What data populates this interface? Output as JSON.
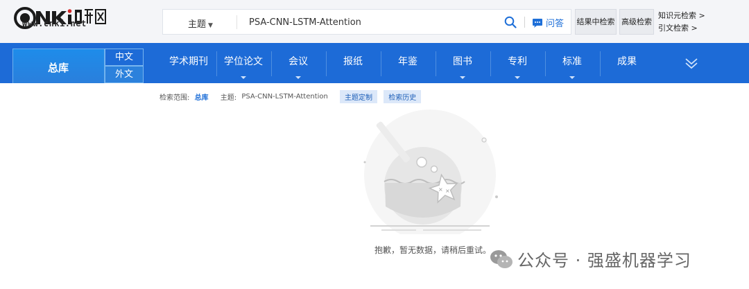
{
  "header": {
    "logo_text": "www.cnki.net",
    "search": {
      "type_label": "主题",
      "query": "PSA-CNN-LSTM-Attention",
      "qa_label": "问答"
    },
    "buttons": {
      "result_search": "结果中检索",
      "advanced_search": "高级检索"
    },
    "side_links": {
      "knowledge": "知识元检索 >",
      "citation": "引文检索 >"
    }
  },
  "nav": {
    "all_label": "总库",
    "lang_zh": "中文",
    "lang_en": "外文",
    "items": [
      {
        "label": "学术期刊",
        "has_dropdown": false
      },
      {
        "label": "学位论文",
        "has_dropdown": true
      },
      {
        "label": "会议",
        "has_dropdown": true
      },
      {
        "label": "报纸",
        "has_dropdown": false
      },
      {
        "label": "年鉴",
        "has_dropdown": false
      },
      {
        "label": "图书",
        "has_dropdown": true
      },
      {
        "label": "专利",
        "has_dropdown": true
      },
      {
        "label": "标准",
        "has_dropdown": true
      },
      {
        "label": "成果",
        "has_dropdown": false
      }
    ]
  },
  "breadcrumb": {
    "scope_label": "检索范围:",
    "scope_value": "总库",
    "topic_label": "主题:",
    "topic_value": "PSA-CNN-LSTM-Attention",
    "custom_tag": "主题定制",
    "history_tag": "检索历史"
  },
  "empty_state": {
    "message": "抱歉，暂无数据，请稍后重试。"
  },
  "watermark": {
    "text": "公众号 · 强盛机器学习"
  },
  "colors": {
    "nav_blue": "#1d6bd7",
    "link_blue": "#1e6fd8",
    "header_bg": "#f4f5f8"
  }
}
